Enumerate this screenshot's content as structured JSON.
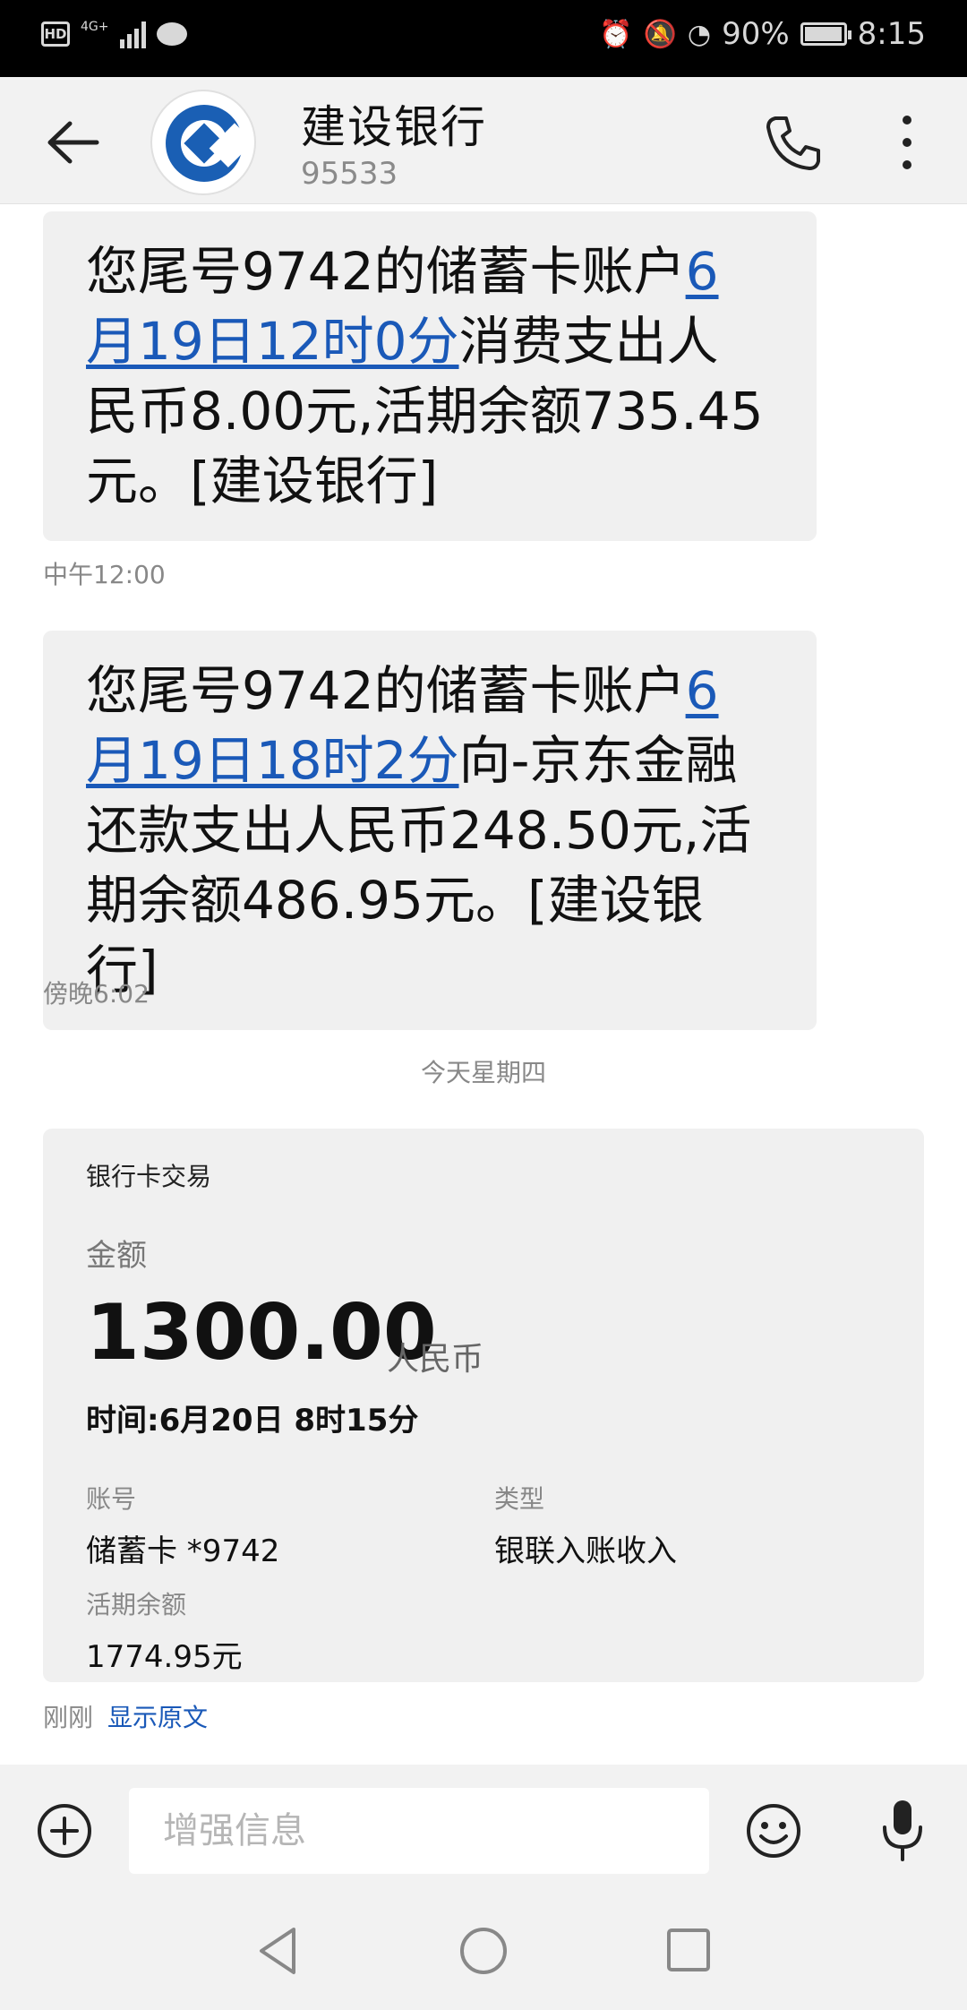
{
  "status_bar": {
    "hd": "HD",
    "network": "4G+",
    "battery_percent": "90%",
    "battery_level": 0.9,
    "time": "8:15",
    "icons": [
      "hd-icon",
      "signal-icon",
      "message-bubble-icon",
      "alarm-icon",
      "mute-icon",
      "speed-icon",
      "battery-icon"
    ]
  },
  "header": {
    "contact_name": "建设银行",
    "contact_number": "95533",
    "icons": [
      "back-arrow-icon",
      "bank-logo-icon",
      "phone-icon",
      "more-vertical-icon"
    ]
  },
  "messages": [
    {
      "text_before": "您尾号9742的储蓄卡账户",
      "link_line1": "6",
      "link_line2": "月19日12时0分",
      "text_after_link": "消费支出人",
      "line3": "民币8.00元,活期余额735.45",
      "line4": "元。[建设银行]",
      "time": "中午12:00"
    },
    {
      "text_before": "您尾号9742的储蓄卡账户",
      "link_line1": "6",
      "link_line2": "月19日18时2分",
      "text_after_link": "向-京东金融",
      "line3": "还款支出人民币248.50元,活",
      "line4": "期余额486.95元。[建设银行]",
      "time": "傍晚6:02"
    }
  ],
  "day_divider": "今天星期四",
  "transaction_card": {
    "title": "银行卡交易",
    "amount_label": "金额",
    "amount": "1300.00",
    "currency": "人民币",
    "time": "时间:6月20日 8时15分",
    "account_label": "账号",
    "account_value": "储蓄卡 *9742",
    "type_label": "类型",
    "type_value": "银联入账收入",
    "balance_label": "活期余额",
    "balance_value": "1774.95元"
  },
  "message_status": {
    "time": "刚刚",
    "show_original": "显示原文"
  },
  "input_bar": {
    "placeholder": "增强信息",
    "icons": [
      "add-icon",
      "emoji-icon",
      "microphone-icon"
    ]
  },
  "nav_bar": {
    "icons": [
      "nav-back-icon",
      "nav-home-icon",
      "nav-recent-apps-icon"
    ]
  },
  "colors": {
    "link": "#1a59b8",
    "bubble": "#f0f0f0",
    "header_bg": "#f2f2f2",
    "ccb_blue": "#1a5fb4"
  }
}
